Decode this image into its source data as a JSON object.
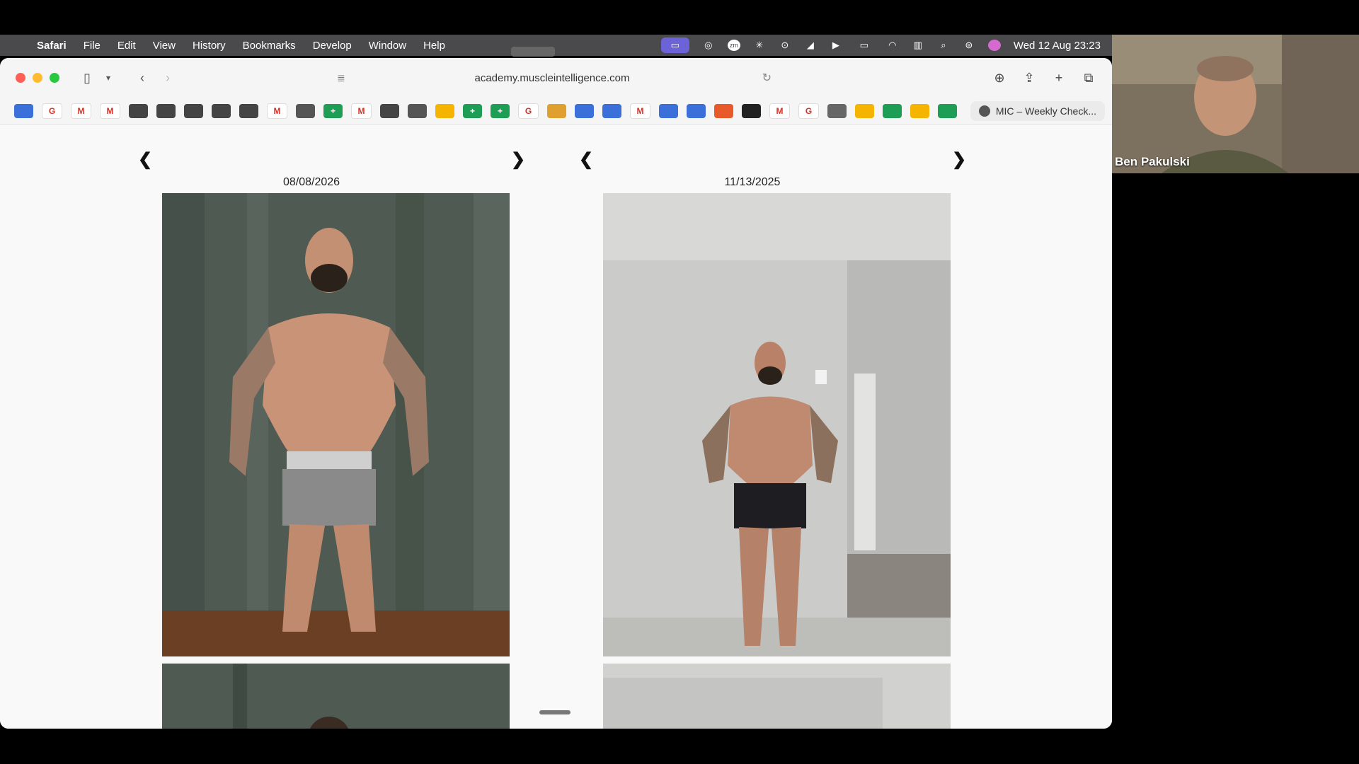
{
  "menubar": {
    "app": "Safari",
    "items": [
      "File",
      "Edit",
      "View",
      "History",
      "Bookmarks",
      "Develop",
      "Window",
      "Help"
    ],
    "clock": "Wed 12 Aug  23:23"
  },
  "browser": {
    "url": "academy.muscleintelligence.com",
    "favorites": [
      {
        "icon": "gear-icon",
        "color": "#3b6fd9",
        "label": ""
      },
      {
        "icon": "google-icon",
        "color": "#ffffff",
        "label": "G"
      },
      {
        "icon": "gmail-icon",
        "color": "#ffffff",
        "label": "M"
      },
      {
        "icon": "gmail-icon",
        "color": "#ffffff",
        "label": "M"
      },
      {
        "icon": "openai-icon",
        "color": "#444444",
        "label": ""
      },
      {
        "icon": "openai-icon",
        "color": "#444444",
        "label": ""
      },
      {
        "icon": "openai-icon",
        "color": "#444444",
        "label": ""
      },
      {
        "icon": "openai-icon",
        "color": "#444444",
        "label": ""
      },
      {
        "icon": "openai-icon",
        "color": "#444444",
        "label": ""
      },
      {
        "icon": "gmail-icon",
        "color": "#ffffff",
        "label": "M"
      },
      {
        "icon": "openai-icon",
        "color": "#555555",
        "label": ""
      },
      {
        "icon": "sheets-icon",
        "color": "#1e9e55",
        "label": "+"
      },
      {
        "icon": "gmail-icon",
        "color": "#ffffff",
        "label": "M"
      },
      {
        "icon": "openai-icon",
        "color": "#444444",
        "label": ""
      },
      {
        "icon": "openai-icon",
        "color": "#555555",
        "label": ""
      },
      {
        "icon": "drive-icon",
        "color": "#f4b400",
        "label": ""
      },
      {
        "icon": "sheets-icon",
        "color": "#1e9e55",
        "label": "+"
      },
      {
        "icon": "sheets-icon",
        "color": "#1e9e55",
        "label": "+"
      },
      {
        "icon": "google-icon",
        "color": "#ffffff",
        "label": "G"
      },
      {
        "icon": "leaf-icon",
        "color": "#e0a030",
        "label": ""
      },
      {
        "icon": "gear-icon",
        "color": "#3b6fd9",
        "label": ""
      },
      {
        "icon": "gear-icon",
        "color": "#3b6fd9",
        "label": ""
      },
      {
        "icon": "gmail-icon",
        "color": "#ffffff",
        "label": "M"
      },
      {
        "icon": "gear-icon",
        "color": "#3b6fd9",
        "label": ""
      },
      {
        "icon": "gear-icon",
        "color": "#3b6fd9",
        "label": ""
      },
      {
        "icon": "bookmark-icon",
        "color": "#e85a2a",
        "label": ""
      },
      {
        "icon": "shield-icon",
        "color": "#222222",
        "label": ""
      },
      {
        "icon": "gmail-icon",
        "color": "#ffffff",
        "label": "M"
      },
      {
        "icon": "google-icon",
        "color": "#ffffff",
        "label": "G"
      },
      {
        "icon": "circle-icon",
        "color": "#666666",
        "label": ""
      },
      {
        "icon": "drive-icon",
        "color": "#f4b400",
        "label": ""
      },
      {
        "icon": "card-icon",
        "color": "#1e9e55",
        "label": ""
      },
      {
        "icon": "drive-icon",
        "color": "#f4b400",
        "label": ""
      },
      {
        "icon": "sheets-icon",
        "color": "#1e9e55",
        "label": ""
      }
    ],
    "active_tab": "MIC – Weekly Check..."
  },
  "comparison": {
    "left": {
      "date": "08/08/2026"
    },
    "right": {
      "date": "11/13/2025"
    },
    "prev_glyph": "❮",
    "next_glyph": "❯"
  },
  "video": {
    "name": "Ben Pakulski"
  }
}
